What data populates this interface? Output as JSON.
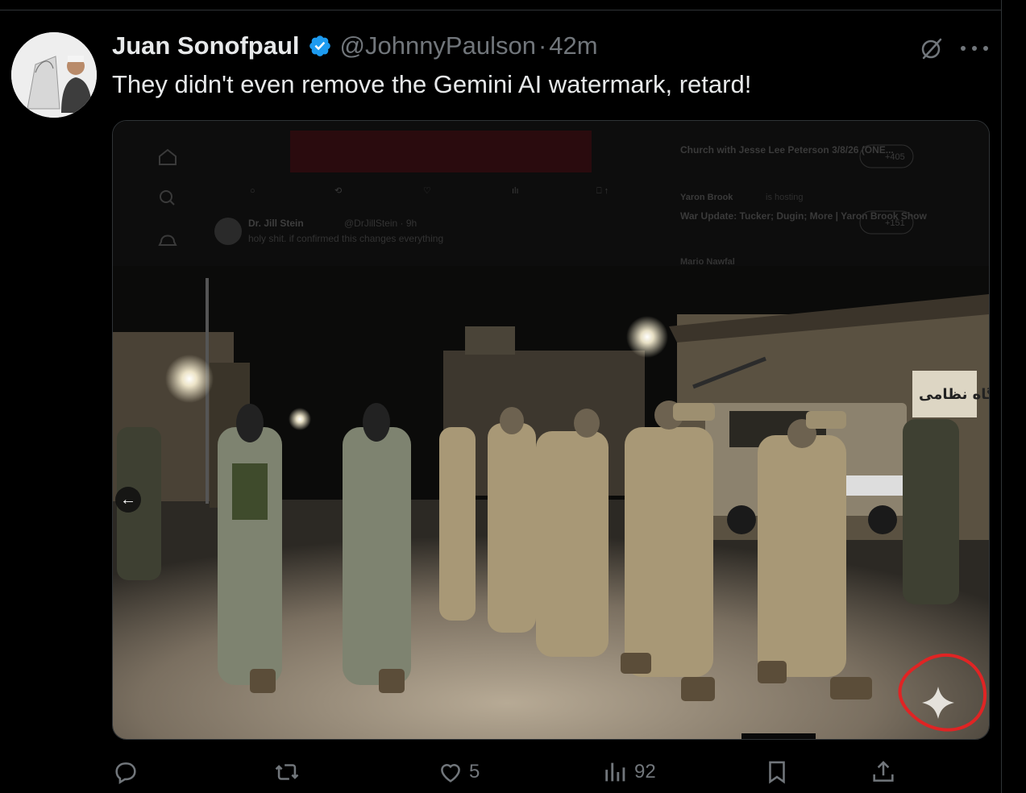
{
  "tweet": {
    "author_name": "Juan Sonofpaul",
    "handle": "@JohnnyPaulson",
    "separator": "·",
    "time": "42m",
    "text": "They didn't even remove the Gemini AI watermark, retard!"
  },
  "embedded_screenshot": {
    "posts": [
      {
        "author": "Dr. Jill Stein",
        "handle": "@DrJillStein · 9h",
        "text": "holy shit. if confirmed this changes everything"
      },
      {
        "author": "",
        "handle": "",
        "text": "Church with Jesse Lee Peterson 3/8/26 (ONE..."
      },
      {
        "author": "Yaron Brook",
        "handle": "is hosting",
        "text": "War Update: Tucker; Dugin; More | Yaron Brook Show"
      },
      {
        "author": "Mario Nawfal",
        "handle": "",
        "text": ""
      }
    ],
    "badges": [
      "+405",
      "+151"
    ],
    "sign_text": "پایگاه نظامی"
  },
  "actions": {
    "reply_count": "",
    "repost_count": "",
    "like_count": "5",
    "views_count": "92"
  },
  "colors": {
    "background": "#000000",
    "text": "#e7e9ea",
    "muted": "#71767b",
    "verified": "#1d9bf0",
    "highlight_circle": "#e02424"
  },
  "icons": {
    "verified": "verified-badge-icon",
    "grok": "grok-icon",
    "more": "more-icon",
    "reply": "reply-icon",
    "repost": "repost-icon",
    "like": "like-icon",
    "views": "views-icon",
    "bookmark": "bookmark-icon",
    "share": "share-icon",
    "watermark": "gemini-sparkle-icon",
    "nav_left": "arrow-left-icon"
  }
}
